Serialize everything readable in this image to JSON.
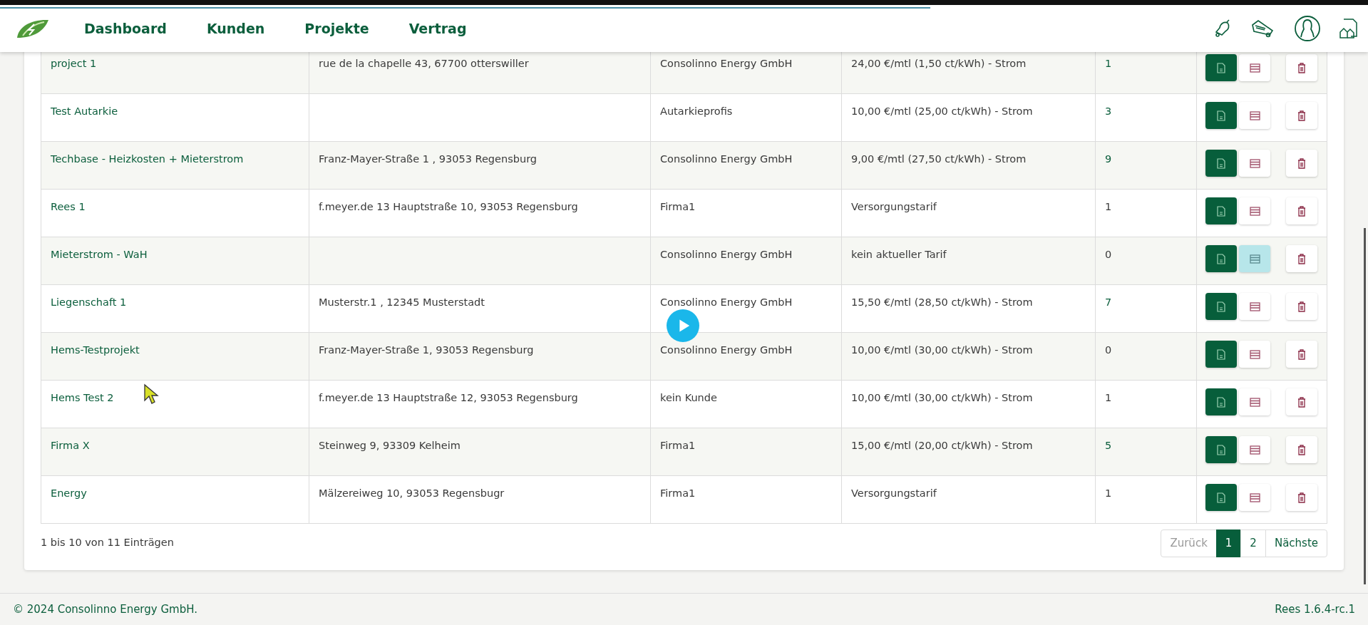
{
  "loading_bar": {
    "level": 0.68
  },
  "nav": [
    {
      "label": "Dashboard"
    },
    {
      "label": "Kunden"
    },
    {
      "label": "Projekte"
    },
    {
      "label": "Vertrag"
    }
  ],
  "table": {
    "rows": [
      {
        "name": "project 1",
        "address": "rue de la chapelle 43, 67700 otterswiller",
        "customer": "Consolinno Energy GmbH",
        "tariff": "24,00 €/mtl (1,50 ct/kWh) - Strom",
        "count": "1",
        "count_linked": true,
        "list_highlighted": false
      },
      {
        "name": "Test Autarkie",
        "customer": "Autarkieprofis",
        "tariff": "10,00 €/mtl (25,00 ct/kWh) - Strom",
        "count": "3",
        "count_linked": true,
        "list_highlighted": false
      },
      {
        "name": "Techbase - Heizkosten + Mieterstrom",
        "address": "Franz-Mayer-Straße 1 , 93053 Regensburg",
        "customer": "Consolinno Energy GmbH",
        "tariff": "9,00 €/mtl (27,50 ct/kWh) - Strom",
        "count": "9",
        "count_linked": true,
        "list_highlighted": false
      },
      {
        "name": "Rees 1",
        "address": "f.meyer.de 13 Hauptstraße 10, 93053 Regensburg",
        "customer": "Firma1",
        "tariff": "Versorgungstarif",
        "count": "1",
        "count_linked": false,
        "list_highlighted": false
      },
      {
        "name": "Mieterstrom - WaH",
        "customer": "Consolinno Energy GmbH",
        "tariff": "kein aktueller Tarif",
        "count": "0",
        "count_linked": false,
        "list_highlighted": true
      },
      {
        "name": "Liegenschaft 1",
        "address": "Musterstr.1 , 12345 Musterstadt",
        "customer": "Consolinno Energy GmbH",
        "tariff": "15,50 €/mtl (28,50 ct/kWh) - Strom",
        "count": "7",
        "count_linked": true,
        "list_highlighted": false
      },
      {
        "name": "Hems-Testprojekt",
        "address": "Franz-Mayer-Straße 1, 93053 Regensburg",
        "customer": "Consolinno Energy GmbH",
        "tariff": "10,00 €/mtl (30,00 ct/kWh) - Strom",
        "count": "0",
        "count_linked": false,
        "list_highlighted": false
      },
      {
        "name": "Hems Test 2",
        "address": "f.meyer.de 13 Hauptstraße 12, 93053 Regensburg",
        "customer": "kein Kunde",
        "tariff": "10,00 €/mtl (30,00 ct/kWh) - Strom",
        "count": "1",
        "count_linked": false,
        "list_highlighted": false
      },
      {
        "name": "Firma X",
        "address": "Steinweg 9, 93309 Kelheim",
        "customer": "Firma1",
        "tariff": "15,00 €/mtl (20,00 ct/kWh) - Strom",
        "count": "5",
        "count_linked": true,
        "list_highlighted": false
      },
      {
        "name": "Energy",
        "address": "Mälzereiweg 10, 93053 Regensbugr",
        "customer": "Firma1",
        "tariff": "Versorgungstarif",
        "count": "1",
        "count_linked": false,
        "list_highlighted": false
      }
    ]
  },
  "entries_info": "1 bis 10 von 11 Einträgen",
  "pagination": [
    {
      "label": "Zurück",
      "selected": false,
      "disabled": true
    },
    {
      "label": "1",
      "selected": true,
      "disabled": false
    },
    {
      "label": "2",
      "selected": false,
      "disabled": false
    },
    {
      "label": "Nächste",
      "selected": false,
      "disabled": false
    }
  ],
  "footer": {
    "copyright": "© 2024 Consolinno Energy GmbH.",
    "version": "Rees 1.6.4-rc.1"
  }
}
